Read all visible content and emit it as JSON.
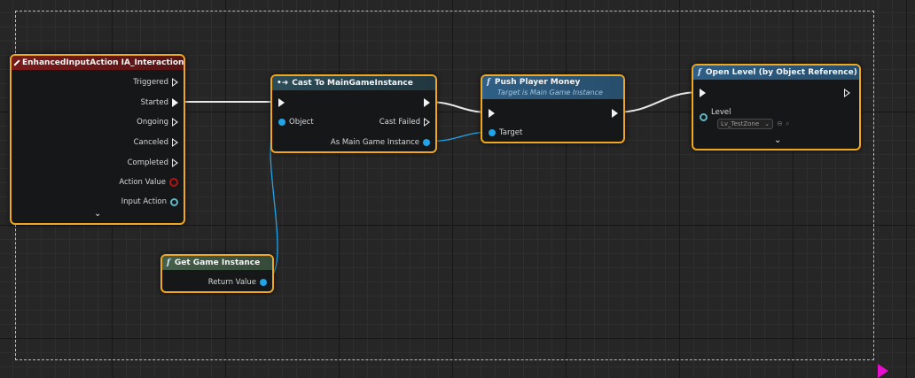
{
  "nodes": {
    "enhanced_input": {
      "title": "EnhancedInputAction IA_Interaction",
      "pins": [
        "Triggered",
        "Started",
        "Ongoing",
        "Canceled",
        "Completed",
        "Action Value",
        "Input Action"
      ]
    },
    "cast": {
      "title": "Cast To MainGameInstance",
      "object_label": "Object",
      "cast_failed_label": "Cast Failed",
      "as_label": "As Main Game Instance"
    },
    "push_money": {
      "title": "Push Player Money",
      "subtitle": "Target is Main Game Instance",
      "target_label": "Target"
    },
    "open_level": {
      "title": "Open Level (by Object Reference)",
      "level_label": "Level",
      "level_value": "Lv_TestZone"
    },
    "get_game_instance": {
      "title": "Get Game Instance",
      "return_label": "Return Value"
    }
  },
  "icons": {
    "function": "f",
    "event": "diamond-icon",
    "cast": "cast-arrow-icon"
  },
  "colors": {
    "selection_border": "#f0a91f",
    "event_header": "#7a1a1a",
    "object_pin": "#1fa5e8",
    "cursor": "#e80ed0"
  }
}
